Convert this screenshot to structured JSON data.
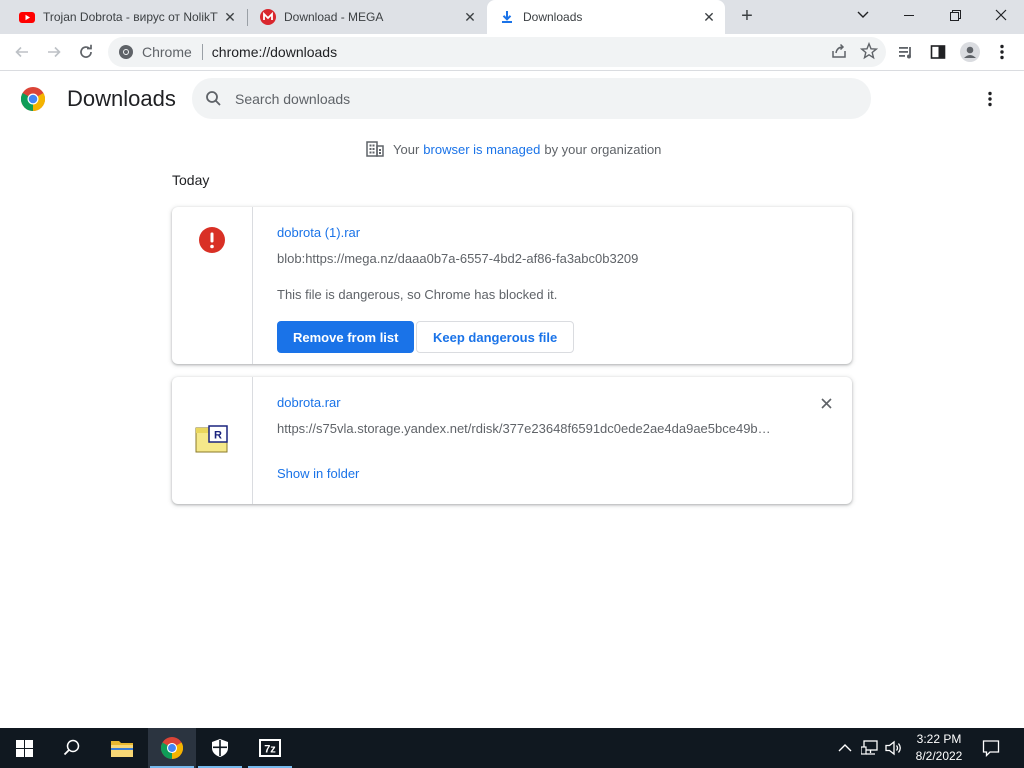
{
  "tabs": [
    {
      "title": "Trojan Dobrota - вирус от NolikTV",
      "icon": "youtube-icon"
    },
    {
      "title": "Download - MEGA",
      "icon": "mega-icon"
    },
    {
      "title": "Downloads",
      "icon": "download-icon"
    }
  ],
  "omnibox": {
    "site_label": "Chrome",
    "url": "chrome://downloads"
  },
  "page": {
    "title": "Downloads",
    "search_placeholder": "Search downloads",
    "managed": {
      "prefix": "Your",
      "link": "browser is managed",
      "suffix": "by your organization"
    },
    "section_date": "Today"
  },
  "downloads": [
    {
      "file_name": "dobrota (1).rar",
      "url": "blob:https://mega.nz/daaa0b7a-6557-4bd2-af86-fa3abc0b3209",
      "description": "This file is dangerous, so Chrome has blocked it.",
      "primary_action": "Remove from list",
      "secondary_action": "Keep dangerous file",
      "icon": "danger-icon"
    },
    {
      "file_name": "dobrota.rar",
      "url": "https://s75vla.storage.yandex.net/rdisk/377e23648f6591dc0ede2ae4da9ae5bce49b…",
      "action": "Show in folder",
      "icon": "rar-file-icon"
    }
  ],
  "taskbar": {
    "time": "3:22 PM",
    "date": "8/2/2022"
  },
  "colors": {
    "accent": "#1a73e8",
    "danger": "#d93025",
    "tabstrip": "#dee1e6",
    "taskbar": "#101820"
  }
}
